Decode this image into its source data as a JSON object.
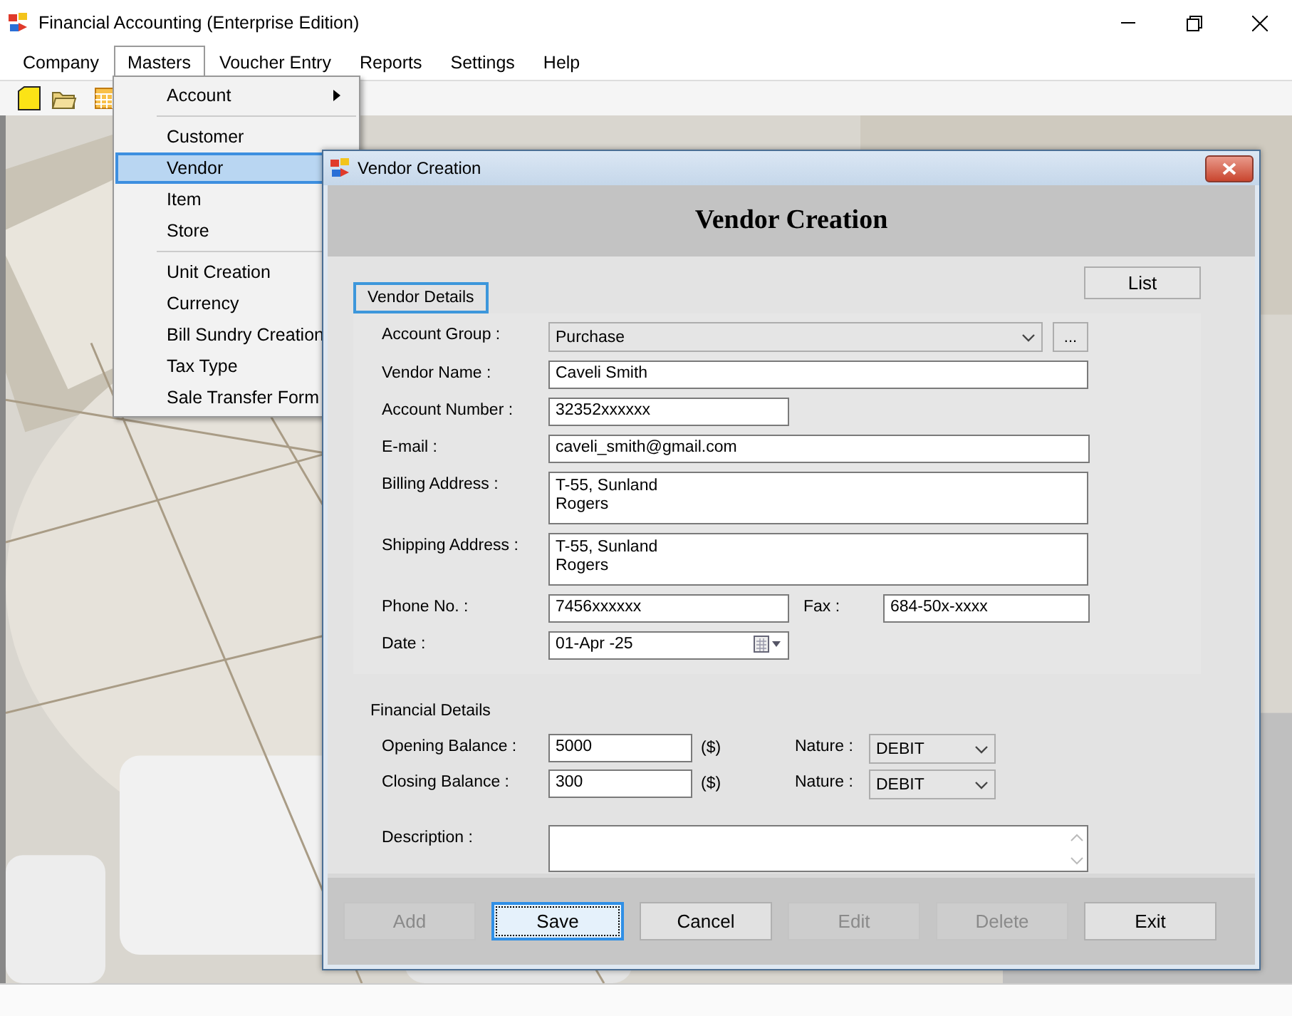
{
  "window": {
    "title": "Financial Accounting (Enterprise Edition)"
  },
  "menu_bar": [
    {
      "label": "Company",
      "selected": false
    },
    {
      "label": "Masters",
      "selected": true
    },
    {
      "label": "Voucher Entry",
      "selected": false
    },
    {
      "label": "Reports",
      "selected": false
    },
    {
      "label": "Settings",
      "selected": false
    },
    {
      "label": "Help",
      "selected": false
    }
  ],
  "masters_menu": [
    {
      "kind": "submenu",
      "label": "Account",
      "selected": false
    },
    {
      "kind": "separator"
    },
    {
      "kind": "item",
      "label": "Customer",
      "selected": false
    },
    {
      "kind": "item",
      "label": "Vendor",
      "selected": true
    },
    {
      "kind": "item",
      "label": "Item",
      "selected": false
    },
    {
      "kind": "item",
      "label": "Store",
      "selected": false
    },
    {
      "kind": "separator"
    },
    {
      "kind": "item",
      "label": "Unit Creation",
      "selected": false
    },
    {
      "kind": "item",
      "label": "Currency",
      "selected": false
    },
    {
      "kind": "item",
      "label": "Bill Sundry Creation",
      "selected": false
    },
    {
      "kind": "item",
      "label": "Tax Type",
      "selected": false
    },
    {
      "kind": "item",
      "label": "Sale Transfer Form",
      "selected": false
    }
  ],
  "dialog": {
    "title": "Vendor Creation",
    "heading": "Vendor Creation",
    "list_button": "List",
    "vendor_details": {
      "legend": "Vendor Details",
      "account_group": {
        "label": "Account Group :",
        "value": "Purchase",
        "browse": "..."
      },
      "vendor_name": {
        "label": "Vendor Name :",
        "value": "Caveli Smith"
      },
      "account_number": {
        "label": "Account Number :",
        "value": "32352xxxxxx"
      },
      "email": {
        "label": "E-mail :",
        "value": "caveli_smith@gmail.com"
      },
      "billing_address": {
        "label": "Billing Address :",
        "value": "T-55, Sunland\nRogers"
      },
      "shipping_address": {
        "label": "Shipping Address :",
        "value": "T-55, Sunland\nRogers"
      },
      "phone": {
        "label": "Phone No. :",
        "value": "7456xxxxxx"
      },
      "fax": {
        "label": "Fax :",
        "value": "684-50x-xxxx"
      },
      "date": {
        "label": "Date :",
        "value": "01-Apr -25"
      }
    },
    "financial_details": {
      "legend": "Financial Details",
      "rows": [
        {
          "label": "Opening Balance :",
          "value": "5000",
          "unit": "($)",
          "nature_label": "Nature :",
          "nature": "DEBIT"
        },
        {
          "label": "Closing Balance :",
          "value": "300",
          "unit": "($)",
          "nature_label": "Nature :",
          "nature": "DEBIT"
        }
      ]
    },
    "description": {
      "label": "Description :"
    },
    "buttons": [
      {
        "label": "Add",
        "disabled": true,
        "focused": false
      },
      {
        "label": "Save",
        "disabled": false,
        "focused": true
      },
      {
        "label": "Cancel",
        "disabled": false,
        "focused": false
      },
      {
        "label": "Edit",
        "disabled": true,
        "focused": false
      },
      {
        "label": "Delete",
        "disabled": true,
        "focused": false
      },
      {
        "label": "Exit",
        "disabled": false,
        "focused": false
      }
    ]
  }
}
